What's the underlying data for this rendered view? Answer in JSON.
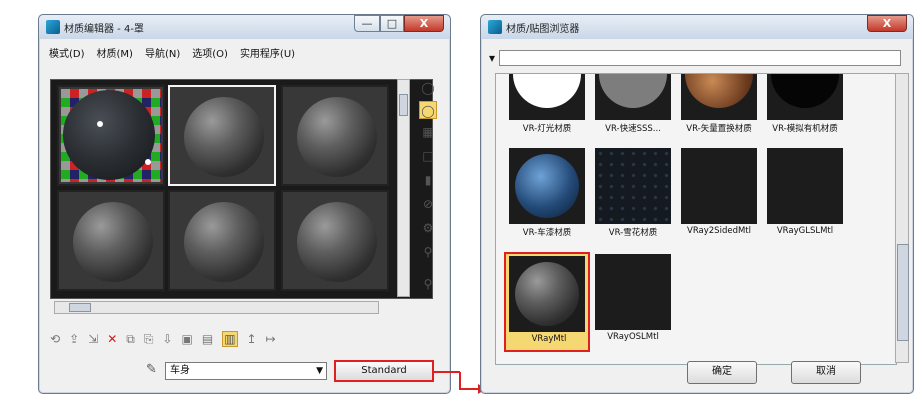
{
  "editor": {
    "title": "材质编辑器 - 4-罩",
    "menu": [
      "模式(D)",
      "材质(M)",
      "导航(N)",
      "选项(O)",
      "实用程序(U)"
    ],
    "name_field": "车身",
    "type_button": "Standard",
    "controls": {
      "minimize": "—",
      "maximize": "□",
      "close": "X"
    }
  },
  "browser": {
    "title": "材质/贴图浏览器",
    "filter_icon": "▾",
    "filter_value": "",
    "items": [
      {
        "label": "VR-灯光材质",
        "thumb": "white"
      },
      {
        "label": "VR-快速SSS...",
        "thumb": "gray"
      },
      {
        "label": "VR-矢量置换材质",
        "thumb": "copper"
      },
      {
        "label": "VR-模拟有机材质",
        "thumb": "black"
      },
      {
        "label": "VR-车漆材质",
        "thumb": "blue-sphere"
      },
      {
        "label": "VR-雪花材质",
        "thumb": "sparkle"
      },
      {
        "label": "VRay2SidedMtl",
        "thumb": "dark"
      },
      {
        "label": "VRayGLSLMtl",
        "thumb": "dark"
      },
      {
        "label": "VRayMtl",
        "thumb": "sphere"
      },
      {
        "label": "VRayOSLMtl",
        "thumb": "dark"
      }
    ],
    "ok_label": "确定",
    "cancel_label": "取消",
    "close_label": "X"
  },
  "icons": {
    "sidebar": [
      "sample-type-icon",
      "backlight-icon",
      "background-icon",
      "uv-tiling-icon",
      "video-color-check-icon",
      "make-preview-icon",
      "options-icon",
      "select-by-material-icon",
      "material-map-navigator-icon"
    ],
    "bottom": [
      "get-material-icon",
      "put-to-scene-icon",
      "assign-to-selection-icon",
      "reset-icon",
      "make-copy-icon",
      "make-unique-icon",
      "put-to-library-icon",
      "material-id-icon",
      "show-map-icon",
      "show-end-result-icon",
      "go-to-parent-icon",
      "go-forward-icon"
    ]
  },
  "colors": {
    "highlight": "#e02020",
    "selected": "#f6d873"
  }
}
